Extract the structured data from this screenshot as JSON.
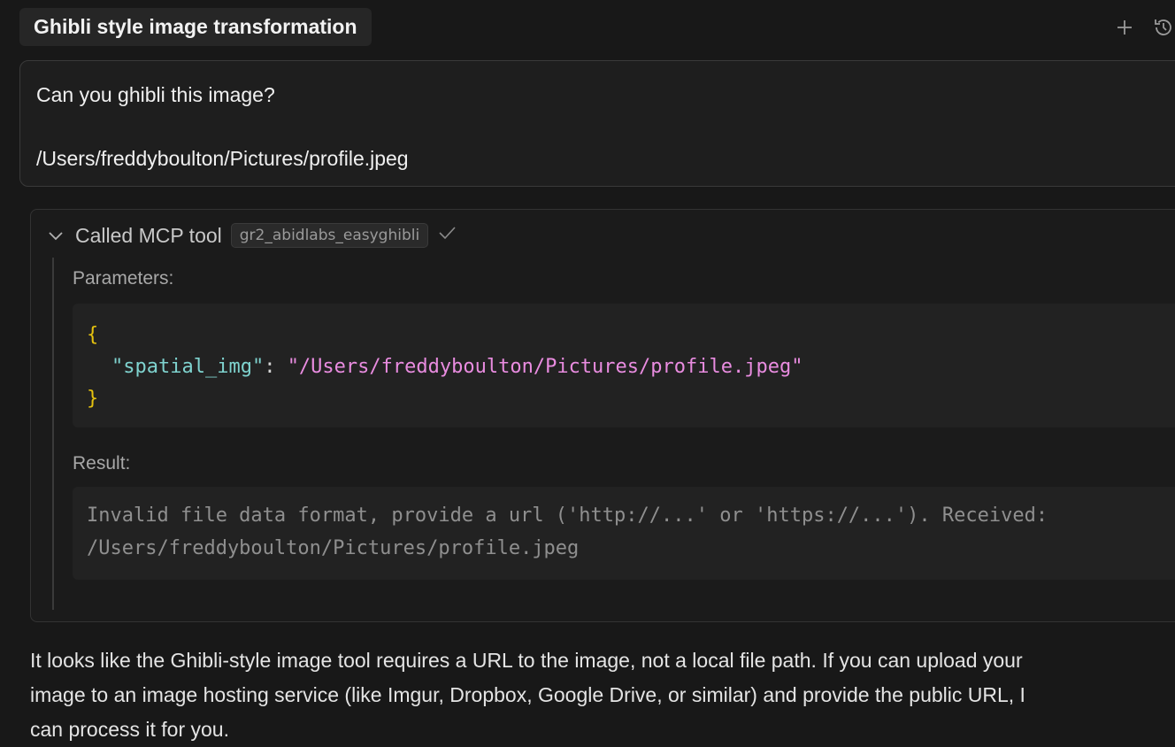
{
  "header": {
    "title": "Ghibli style image transformation",
    "icons": [
      "plus-icon",
      "history-icon"
    ]
  },
  "user_message": {
    "line1": "Can you ghibli this image?",
    "line2": "/Users/freddyboulton/Pictures/profile.jpeg"
  },
  "tool_call": {
    "label": "Called MCP tool",
    "tool_name": "gr2_abidlabs_easyghibli",
    "parameters_label": "Parameters:",
    "param_open": "{",
    "param_key": "\"spatial_img\"",
    "param_colon": ": ",
    "param_value": "\"/Users/freddyboulton/Pictures/profile.jpeg\"",
    "param_close": "}",
    "result_label": "Result:",
    "result_line1": "Invalid file data format, provide a url ('http://...' or 'https://...'). Received:",
    "result_line2": "/Users/freddyboulton/Pictures/profile.jpeg"
  },
  "assistant": {
    "line1": "It looks like the Ghibli-style image tool requires a URL to the image, not a local file path. If you can upload your",
    "line2": "image to an image hosting service (like Imgur, Dropbox, Google Drive, or similar) and provide the public URL, I",
    "line3": "can process it for you."
  },
  "colors": {
    "background": "#181818",
    "json_brace": "#e5c20f",
    "json_key": "#7fd3cf",
    "json_string": "#e98ce0"
  }
}
